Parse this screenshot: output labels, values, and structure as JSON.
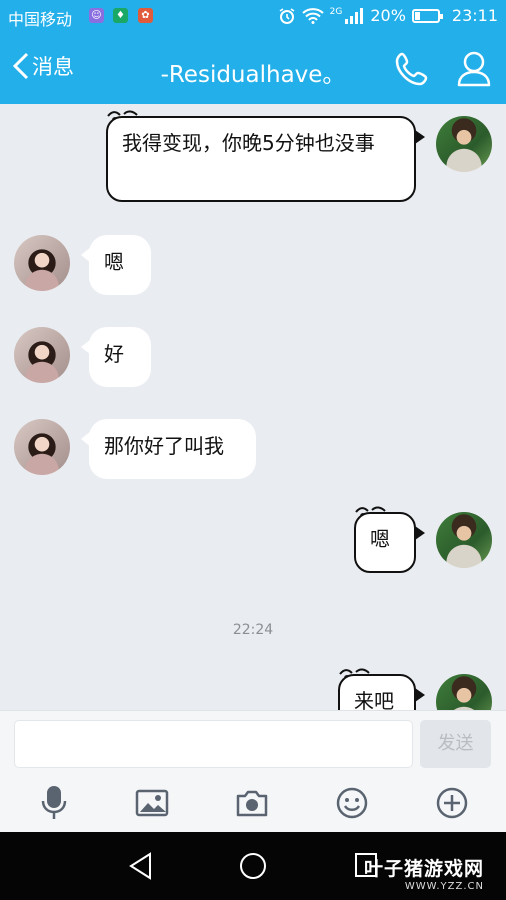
{
  "status_bar": {
    "carrier": "中国移动",
    "network": "2G",
    "battery_percent": "20%",
    "battery_level": 0.2,
    "time": "23:11"
  },
  "header": {
    "back_label": "消息",
    "title": "-Residualhave。"
  },
  "messages": [
    {
      "from": "me",
      "text": "我得变现，你晚5分钟也没事"
    },
    {
      "from": "them",
      "text": "嗯"
    },
    {
      "from": "them",
      "text": "好"
    },
    {
      "from": "them",
      "text": "那你好了叫我"
    },
    {
      "from": "me",
      "text": "嗯"
    },
    {
      "from": "me",
      "text": "来吧"
    }
  ],
  "timestamp": "22:24",
  "input": {
    "value": "",
    "placeholder": ""
  },
  "send_label": "发送",
  "toolbar": [
    "microphone-icon",
    "image-icon",
    "camera-icon",
    "emoji-icon",
    "plus-icon"
  ],
  "watermark": {
    "brand": "叶子猪游戏网",
    "url": "WWW.YZZ.CN"
  },
  "colors": {
    "accent": "#23b0ea",
    "chat_bg": "#e9ecf0"
  }
}
